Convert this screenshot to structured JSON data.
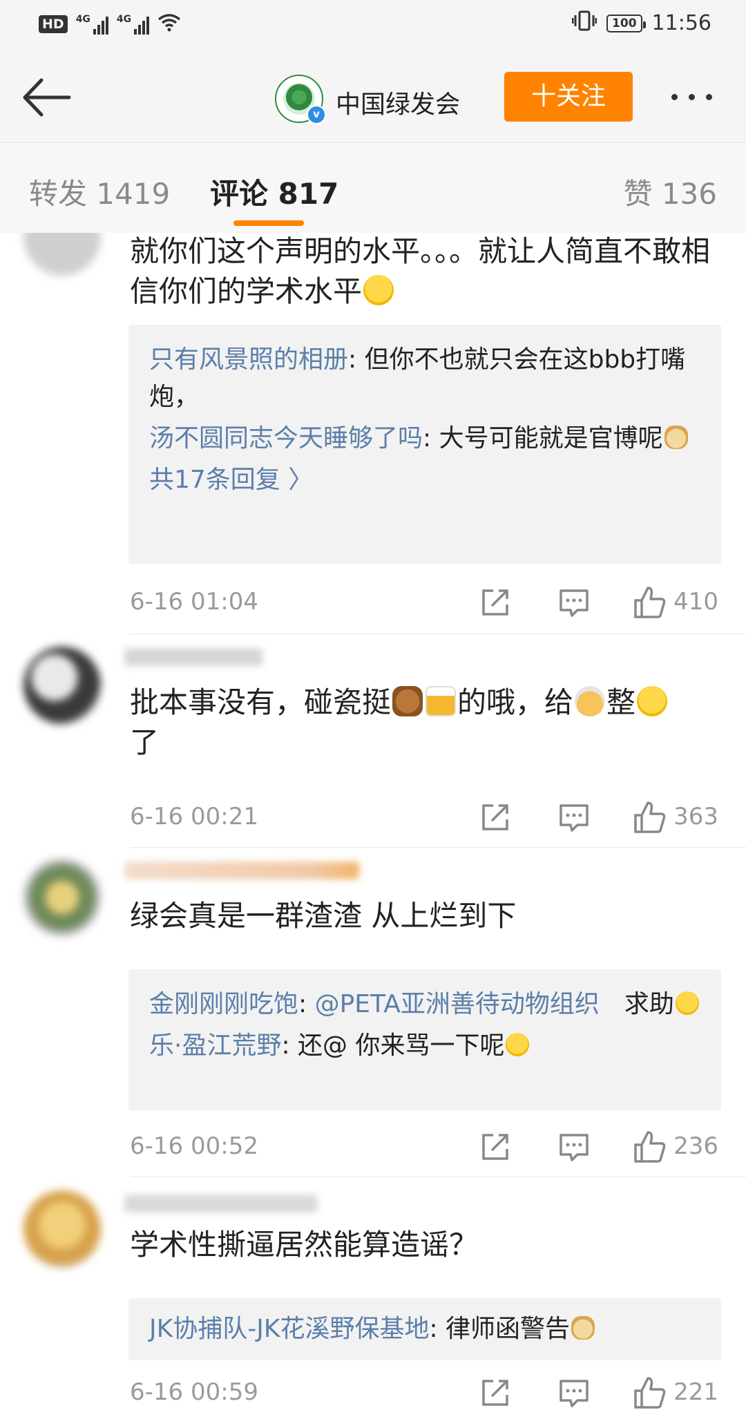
{
  "status_bar": {
    "hd": "HD",
    "signal1": "4G",
    "signal2": "4G",
    "battery": "100",
    "time": "11:56"
  },
  "nav": {
    "account_name": "中国绿发会",
    "follow_label": "十关注",
    "verified_mark": "v"
  },
  "tabs": {
    "repost": "转发 1419",
    "comments": "评论 817",
    "likes": "赞 136"
  },
  "colors": {
    "accent": "#ff8200",
    "link": "#5b7faa",
    "meta": "#9a9a9a"
  },
  "comments": [
    {
      "text": "就你们这个声明的水平。。。就让人简直不敢相信你们的学术水平",
      "emoji": "sweat-smile-emoji",
      "replies": [
        {
          "name": "只有风景照的相册",
          "sep": ": ",
          "text": "但你不也就只会在这bbb打嘴炮，"
        },
        {
          "name": "汤不圆同志今天睡够了吗",
          "sep": ": ",
          "text": "大号可能就是官博呢",
          "emoji": "doge-emoji"
        }
      ],
      "more": "共17条回复 〉",
      "time": "6-16 01:04",
      "likes": "410"
    },
    {
      "text_a": "批本事没有，碰瓷挺",
      "text_b": "的哦，给",
      "text_c": "整",
      "text_d": "了",
      "time": "6-16 00:21",
      "likes": "363"
    },
    {
      "text": "绿会真是一群渣渣 从上烂到下",
      "replies": [
        {
          "name": "金刚刚刚吃饱",
          "sep": ": ",
          "mention": "@PETA亚洲善待动物组织",
          "text": "　求助"
        },
        {
          "name": "乐·盈江荒野",
          "sep": ": ",
          "text": "还@ 你来骂一下呢"
        }
      ],
      "time": "6-16 00:52",
      "likes": "236"
    },
    {
      "text": "学术性撕逼居然能算造谣？",
      "replies": [
        {
          "name": "JK协捕队-JK花溪野保基地",
          "sep": ": ",
          "text": "律师函警告"
        }
      ],
      "time": "6-16 00:59",
      "likes": "221"
    }
  ]
}
